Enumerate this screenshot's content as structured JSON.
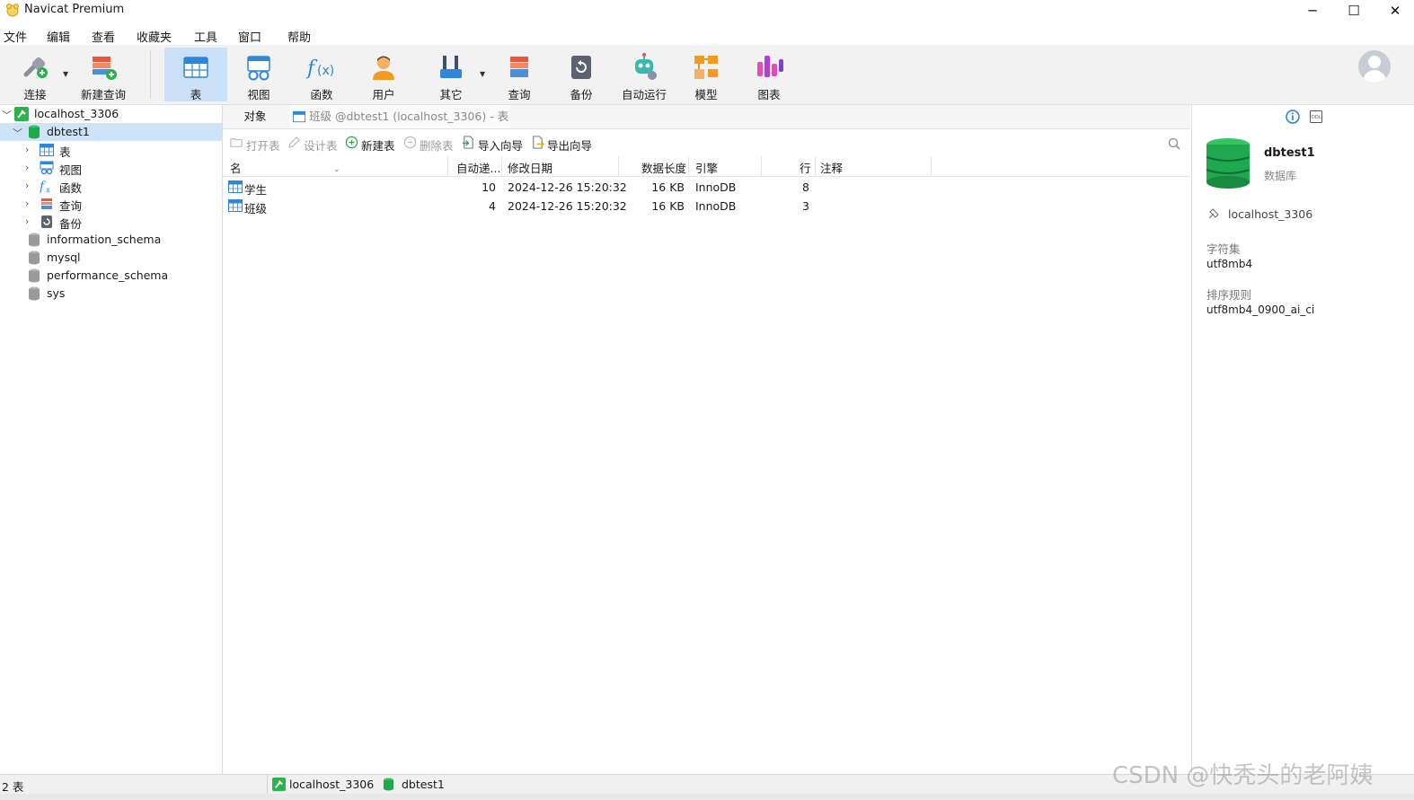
{
  "window": {
    "title": "Navicat Premium",
    "minimize": "─",
    "maximize": "☐",
    "close": "✕"
  },
  "menu": [
    "文件",
    "编辑",
    "查看",
    "收藏夹",
    "工具",
    "窗口",
    "帮助"
  ],
  "toolbar": {
    "items": [
      {
        "label": "连接",
        "icon": "plug-icon"
      },
      {
        "label": "新建查询",
        "icon": "new-query-icon"
      },
      {
        "label": "表",
        "icon": "table-icon",
        "active": true
      },
      {
        "label": "视图",
        "icon": "view-icon"
      },
      {
        "label": "函数",
        "icon": "function-icon"
      },
      {
        "label": "用户",
        "icon": "user-icon"
      },
      {
        "label": "其它",
        "icon": "tools-icon"
      },
      {
        "label": "查询",
        "icon": "query-icon"
      },
      {
        "label": "备份",
        "icon": "backup-icon"
      },
      {
        "label": "自动运行",
        "icon": "robot-icon"
      },
      {
        "label": "模型",
        "icon": "model-icon"
      },
      {
        "label": "图表",
        "icon": "chart-icon"
      }
    ]
  },
  "tree": {
    "connection": "localhost_3306",
    "database": "dbtest1",
    "children": [
      {
        "label": "表",
        "icon": "table-icon"
      },
      {
        "label": "视图",
        "icon": "view-icon"
      },
      {
        "label": "函数",
        "icon": "function-icon"
      },
      {
        "label": "查询",
        "icon": "query-icon"
      },
      {
        "label": "备份",
        "icon": "backup-icon"
      }
    ],
    "other_databases": [
      "information_schema",
      "mysql",
      "performance_schema",
      "sys"
    ]
  },
  "tabs": {
    "objects": "对象",
    "document": "班级 @dbtest1 (localhost_3306) - 表"
  },
  "object_toolbar": {
    "open": "打开表",
    "design": "设计表",
    "new": "新建表",
    "delete": "删除表",
    "import": "导入向导",
    "export": "导出向导"
  },
  "grid": {
    "columns": [
      "名",
      "自动递...",
      "修改日期",
      "数据长度",
      "引擎",
      "行",
      "注释"
    ],
    "rows": [
      {
        "name": "学生",
        "auto_inc": "10",
        "modified": "2024-12-26 15:20:32",
        "size": "16 KB",
        "engine": "InnoDB",
        "rows": "8",
        "comment": ""
      },
      {
        "name": "班级",
        "auto_inc": "4",
        "modified": "2024-12-26 15:20:32",
        "size": "16 KB",
        "engine": "InnoDB",
        "rows": "3",
        "comment": ""
      }
    ]
  },
  "info": {
    "db_name": "dbtest1",
    "db_type": "数据库",
    "connection": "localhost_3306",
    "charset_label": "字符集",
    "charset": "utf8mb4",
    "collation_label": "排序规则",
    "collation": "utf8mb4_0900_ai_ci"
  },
  "status": {
    "count": "2 表",
    "connection": "localhost_3306",
    "database": "dbtest1"
  },
  "watermark": "CSDN @快秃头的老阿姨",
  "colors": {
    "accent": "#1a7fd6",
    "db_green": "#1fa84f",
    "selected": "#cce3f8"
  }
}
